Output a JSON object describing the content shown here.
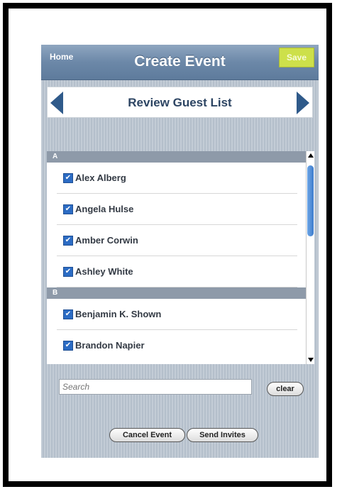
{
  "navbar": {
    "home_label": "Home",
    "title": "Create Event",
    "save_label": "Save"
  },
  "subbar": {
    "title": "Review Guest List"
  },
  "guest_list": {
    "sections": [
      {
        "letter": "A",
        "guests": [
          {
            "name": "Alex Alberg",
            "checked": true
          },
          {
            "name": "Angela Hulse",
            "checked": true
          },
          {
            "name": "Amber Corwin",
            "checked": true
          },
          {
            "name": "Ashley White",
            "checked": true
          }
        ]
      },
      {
        "letter": "B",
        "guests": [
          {
            "name": "Benjamin K. Shown",
            "checked": true
          },
          {
            "name": "Brandon Napier",
            "checked": true
          }
        ]
      }
    ]
  },
  "search": {
    "placeholder": "Search",
    "value": "",
    "clear_label": "clear"
  },
  "actions": {
    "cancel_label": "Cancel Event",
    "send_label": "Send Invites"
  },
  "colors": {
    "navbar": "#6c88a8",
    "save_button": "#cde04a",
    "checkbox": "#2c6cc4",
    "section_header": "#8e9aa9"
  }
}
